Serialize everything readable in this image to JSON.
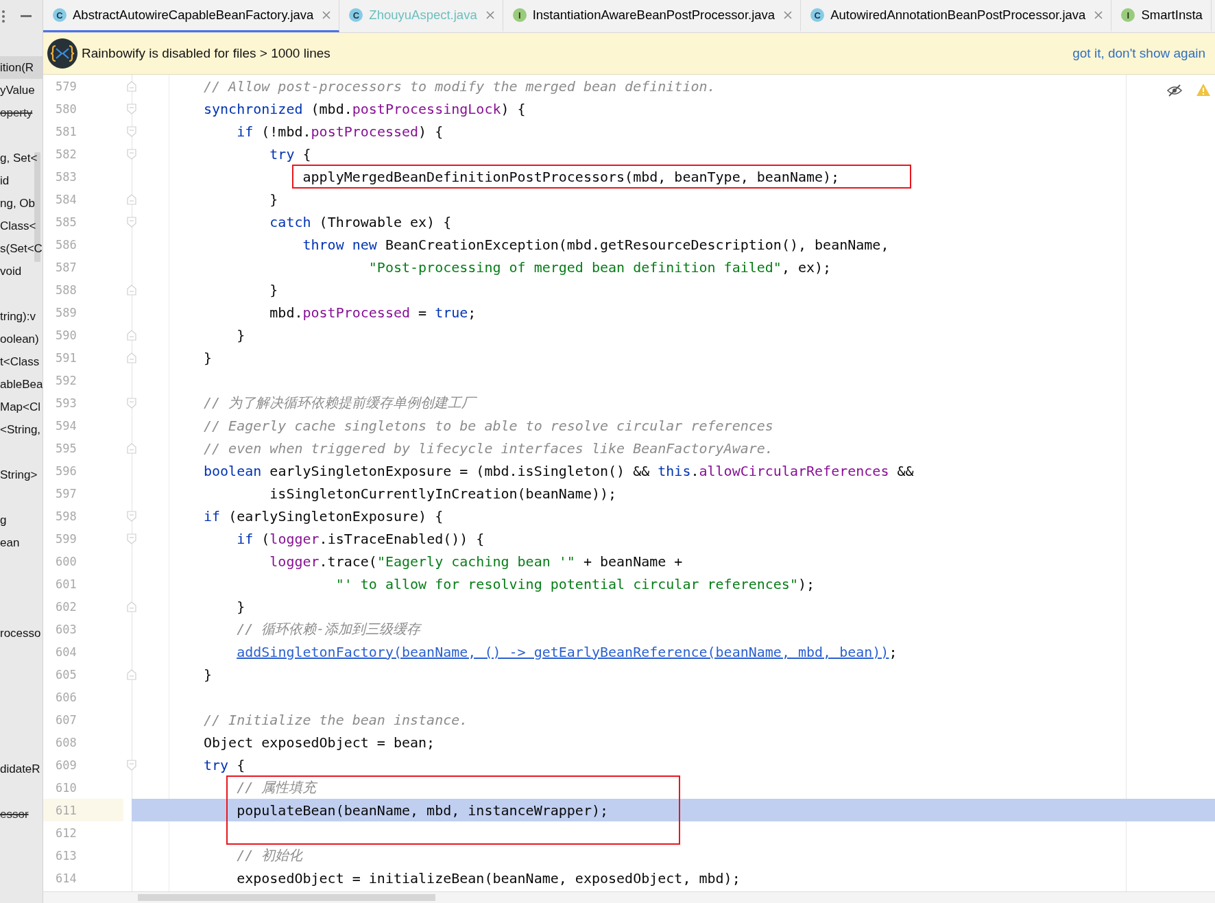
{
  "sidebar": {
    "items": [
      {
        "text": "ition(R",
        "selected": true,
        "strikethrough": false
      },
      {
        "text": "yValue",
        "selected": false,
        "strikethrough": false
      },
      {
        "text": "operty",
        "selected": false,
        "strikethrough": true
      },
      {
        "selected": false
      },
      {
        "text": "g, Set<",
        "selected": false,
        "strikethrough": false
      },
      {
        "text": "id",
        "selected": false,
        "strikethrough": false
      },
      {
        "text": "ng, Ob",
        "selected": false,
        "strikethrough": false
      },
      {
        "text": "Class<",
        "selected": false,
        "strikethrough": false
      },
      {
        "text": "s(Set<C",
        "selected": false,
        "strikethrough": false
      },
      {
        "text": "void",
        "selected": false,
        "strikethrough": false
      },
      {
        "selected": false
      },
      {
        "text": "tring):v",
        "selected": false,
        "strikethrough": false
      },
      {
        "text": "oolean)",
        "selected": false,
        "strikethrough": false
      },
      {
        "text": "t<Class",
        "selected": false,
        "strikethrough": false
      },
      {
        "text": "ableBea",
        "selected": false,
        "strikethrough": false
      },
      {
        "text": "Map<Cl",
        "selected": false,
        "strikethrough": false
      },
      {
        "text": "<String,",
        "selected": false,
        "strikethrough": false
      },
      {
        "selected": false
      },
      {
        "text": "String>",
        "selected": false,
        "strikethrough": false
      },
      {
        "selected": false
      },
      {
        "text": "g",
        "selected": false,
        "strikethrough": false
      },
      {
        "text": "ean",
        "selected": false,
        "strikethrough": false
      },
      {
        "selected": false
      },
      {
        "selected": false
      },
      {
        "selected": false
      },
      {
        "text": "rocesso",
        "selected": false,
        "strikethrough": false
      },
      {
        "selected": false
      },
      {
        "selected": false
      },
      {
        "selected": false
      },
      {
        "selected": false
      },
      {
        "selected": false
      },
      {
        "text": "didateR",
        "selected": false,
        "strikethrough": false
      },
      {
        "selected": false
      },
      {
        "text": "essor",
        "selected": false,
        "strikethrough": true
      }
    ]
  },
  "tabs": [
    {
      "label": "AbstractAutowireCapableBeanFactory.java",
      "kind": "class",
      "badge": "C",
      "color": "#000000",
      "selected": true,
      "closable": true
    },
    {
      "label": "ZhouyuAspect.java",
      "kind": "class",
      "badge": "C",
      "color": "#6cbfbf",
      "selected": false,
      "closable": true
    },
    {
      "label": "InstantiationAwareBeanPostProcessor.java",
      "kind": "interface",
      "badge": "I",
      "color": "#000000",
      "selected": false,
      "closable": true
    },
    {
      "label": "AutowiredAnnotationBeanPostProcessor.java",
      "kind": "class",
      "badge": "C",
      "color": "#000000",
      "selected": false,
      "closable": true
    },
    {
      "label": "SmartInsta",
      "kind": "interface",
      "badge": "I",
      "color": "#000000",
      "selected": false,
      "closable": false
    }
  ],
  "banner": {
    "message": "Rainbowify is disabled for files > 1000 lines",
    "action": "got it, don't show again"
  },
  "editor": {
    "lines": [
      {
        "number": "579",
        "kind": "fold_end",
        "tokens": [
          {
            "kind": "comment",
            "text": "// Allow post-processors to modify the merged bean definition."
          }
        ]
      },
      {
        "number": "580",
        "kind": "fold_start",
        "tokens": [
          {
            "kind": "keyword",
            "text": "synchronized"
          },
          {
            "kind": "plain",
            "text": " (mbd."
          },
          {
            "kind": "field",
            "text": "postProcessingLock"
          },
          {
            "kind": "plain",
            "text": ") {"
          }
        ]
      },
      {
        "number": "581",
        "kind": "fold_start",
        "tokens": [
          {
            "kind": "keyword",
            "text": "    if"
          },
          {
            "kind": "plain",
            "text": " (!mbd."
          },
          {
            "kind": "field",
            "text": "postProcessed"
          },
          {
            "kind": "plain",
            "text": ") {"
          }
        ]
      },
      {
        "number": "582",
        "kind": "fold_start",
        "tokens": [
          {
            "kind": "keyword",
            "text": "        try"
          },
          {
            "kind": "plain",
            "text": " {"
          }
        ]
      },
      {
        "number": "583",
        "boxed": true,
        "tokens": [
          {
            "kind": "plain",
            "text": "            applyMergedBeanDefinitionPostProcessors(mbd, beanType, beanName);"
          }
        ]
      },
      {
        "number": "584",
        "kind": "fold_end",
        "tokens": [
          {
            "kind": "plain",
            "text": "        }"
          }
        ]
      },
      {
        "number": "585",
        "kind": "fold_start",
        "tokens": [
          {
            "kind": "keyword",
            "text": "        catch"
          },
          {
            "kind": "plain",
            "text": " (Throwable ex) {"
          }
        ]
      },
      {
        "number": "586",
        "tokens": [
          {
            "kind": "keyword",
            "text": "            throw new"
          },
          {
            "kind": "plain",
            "text": " BeanCreationException(mbd.getResourceDescription(), beanName,"
          }
        ]
      },
      {
        "number": "587",
        "tokens": [
          {
            "kind": "string",
            "text": "                    \"Post-processing of merged bean definition failed\""
          },
          {
            "kind": "plain",
            "text": ", ex);"
          }
        ]
      },
      {
        "number": "588",
        "kind": "fold_end",
        "tokens": [
          {
            "kind": "plain",
            "text": "        }"
          }
        ]
      },
      {
        "number": "589",
        "tokens": [
          {
            "kind": "plain",
            "text": "        mbd."
          },
          {
            "kind": "field",
            "text": "postProcessed"
          },
          {
            "kind": "plain",
            "text": " = "
          },
          {
            "kind": "keyword",
            "text": "true"
          },
          {
            "kind": "plain",
            "text": ";"
          }
        ]
      },
      {
        "number": "590",
        "kind": "fold_end",
        "tokens": [
          {
            "kind": "plain",
            "text": "    }"
          }
        ]
      },
      {
        "number": "591",
        "kind": "fold_end",
        "tokens": [
          {
            "kind": "plain",
            "text": "}"
          }
        ]
      },
      {
        "number": "592"
      },
      {
        "number": "593",
        "kind": "fold_start",
        "tokens": [
          {
            "kind": "comment",
            "text": "// 为了解决循环依赖提前缓存单例创建工厂"
          }
        ]
      },
      {
        "number": "594",
        "tokens": [
          {
            "kind": "comment",
            "text": "// Eagerly cache singletons to be able to resolve circular references"
          }
        ]
      },
      {
        "number": "595",
        "kind": "fold_end",
        "tokens": [
          {
            "kind": "comment",
            "text": "// even when triggered by lifecycle interfaces like BeanFactoryAware."
          }
        ]
      },
      {
        "number": "596",
        "tokens": [
          {
            "kind": "keyword",
            "text": "boolean"
          },
          {
            "kind": "plain",
            "text": " earlySingletonExposure = (mbd.isSingleton() && "
          },
          {
            "kind": "keyword",
            "text": "this"
          },
          {
            "kind": "plain",
            "text": "."
          },
          {
            "kind": "field",
            "text": "allowCircularReferences"
          },
          {
            "kind": "plain",
            "text": " &&"
          }
        ]
      },
      {
        "number": "597",
        "tokens": [
          {
            "kind": "plain",
            "text": "        isSingletonCurrentlyInCreation(beanName));"
          }
        ]
      },
      {
        "number": "598",
        "kind": "fold_start",
        "tokens": [
          {
            "kind": "keyword",
            "text": "if"
          },
          {
            "kind": "plain",
            "text": " (earlySingletonExposure) {"
          }
        ]
      },
      {
        "number": "599",
        "kind": "fold_start",
        "tokens": [
          {
            "kind": "keyword",
            "text": "    if"
          },
          {
            "kind": "plain",
            "text": " ("
          },
          {
            "kind": "field",
            "text": "logger"
          },
          {
            "kind": "plain",
            "text": ".isTraceEnabled()) {"
          }
        ]
      },
      {
        "number": "600",
        "tokens": [
          {
            "kind": "field",
            "text": "        logger"
          },
          {
            "kind": "plain",
            "text": ".trace("
          },
          {
            "kind": "string",
            "text": "\"Eagerly caching bean '\""
          },
          {
            "kind": "plain",
            "text": " + beanName +"
          }
        ]
      },
      {
        "number": "601",
        "tokens": [
          {
            "kind": "string",
            "text": "                \"' to allow for resolving potential circular references\""
          },
          {
            "kind": "plain",
            "text": ");"
          }
        ]
      },
      {
        "number": "602",
        "kind": "fold_end",
        "tokens": [
          {
            "kind": "plain",
            "text": "    }"
          }
        ]
      },
      {
        "number": "603",
        "tokens": [
          {
            "kind": "comment",
            "text": "    // 循环依赖-添加到三级缓存"
          }
        ]
      },
      {
        "number": "604",
        "tokens": [
          {
            "kind": "link",
            "text": "    addSingletonFactory(beanName, () -> getEarlyBeanReference(beanName, mbd, bean))"
          },
          {
            "kind": "plain",
            "text": ";"
          }
        ]
      },
      {
        "number": "605",
        "kind": "fold_end",
        "tokens": [
          {
            "kind": "plain",
            "text": "}"
          }
        ]
      },
      {
        "number": "606"
      },
      {
        "number": "607",
        "tokens": [
          {
            "kind": "comment",
            "text": "// Initialize the bean instance."
          }
        ]
      },
      {
        "number": "608",
        "tokens": [
          {
            "kind": "plain",
            "text": "Object exposedObject = bean;"
          }
        ]
      },
      {
        "number": "609",
        "kind": "fold_start",
        "tokens": [
          {
            "kind": "keyword",
            "text": "try"
          },
          {
            "kind": "plain",
            "text": " {"
          }
        ]
      },
      {
        "number": "610",
        "boxed": true,
        "tokens": [
          {
            "kind": "comment",
            "text": "    // 属性填充"
          }
        ]
      },
      {
        "number": "611",
        "boxed": true,
        "current": true,
        "tokens": [
          {
            "kind": "plain",
            "text": "    populateBean(beanName, mbd, instanceWrapper);"
          }
        ]
      },
      {
        "number": "612",
        "boxed": true
      },
      {
        "number": "613",
        "tokens": [
          {
            "kind": "comment",
            "text": "    // 初始化"
          }
        ]
      },
      {
        "number": "614",
        "tokens": [
          {
            "kind": "plain",
            "text": "    exposedObject = initializeBean(beanName, exposedObject, mbd);"
          }
        ]
      }
    ]
  }
}
